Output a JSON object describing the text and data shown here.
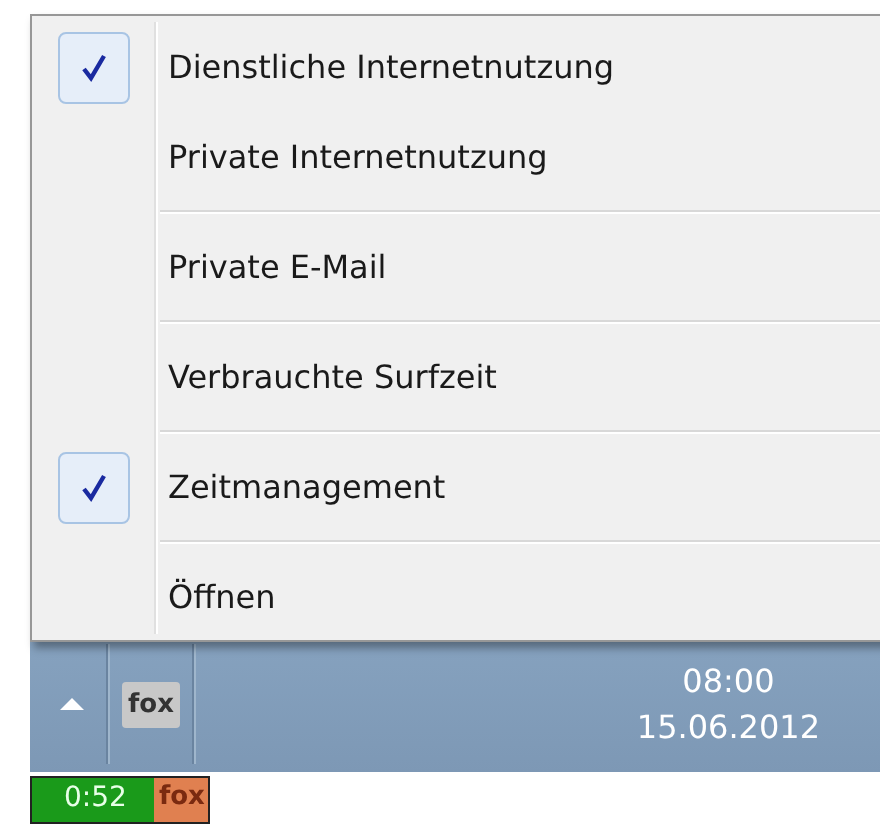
{
  "context_menu": {
    "items": [
      {
        "kind": "item",
        "label": "Dienstliche Internetnutzung",
        "checked": true
      },
      {
        "kind": "item",
        "label": "Private Internetnutzung",
        "checked": false
      },
      {
        "kind": "separator"
      },
      {
        "kind": "item",
        "label": "Private E-Mail",
        "checked": false
      },
      {
        "kind": "separator"
      },
      {
        "kind": "item",
        "label": "Verbrauchte Surfzeit",
        "checked": false
      },
      {
        "kind": "separator"
      },
      {
        "kind": "item",
        "label": "Zeitmanagement",
        "checked": true
      },
      {
        "kind": "separator"
      },
      {
        "kind": "item",
        "label": "Öffnen",
        "checked": false
      }
    ]
  },
  "taskbar": {
    "tray_icon_label": "fox",
    "clock": {
      "time": "08:00",
      "date": "15.06.2012"
    }
  },
  "timer_badge": {
    "time": "0:52",
    "label": "fox"
  }
}
